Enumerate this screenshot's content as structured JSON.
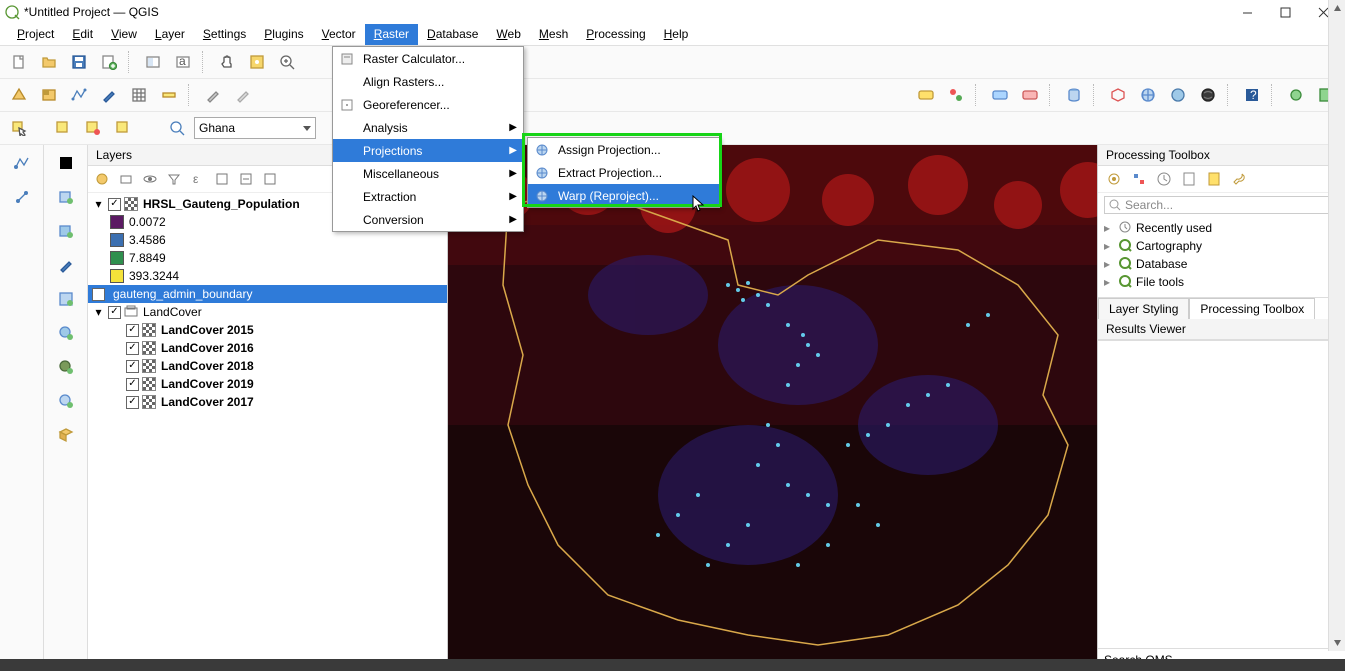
{
  "window": {
    "title": "*Untitled Project — QGIS"
  },
  "menubar": [
    "Project",
    "Edit",
    "View",
    "Layer",
    "Settings",
    "Plugins",
    "Vector",
    "Raster",
    "Database",
    "Web",
    "Mesh",
    "Processing",
    "Help"
  ],
  "menubar_active": "Raster",
  "toolbar3": {
    "combo_value": "Ghana"
  },
  "layers_panel": {
    "title": "Layers",
    "tree": [
      {
        "expand": "open",
        "checked": true,
        "icon": "raster",
        "label": "HRSL_Gauteng_Population",
        "bold": true,
        "children": [
          {
            "swatch": "#5b1a63",
            "label": "0.0072"
          },
          {
            "swatch": "#3b6fb0",
            "label": "3.4586"
          },
          {
            "swatch": "#2f8f4e",
            "label": "7.8849"
          },
          {
            "swatch": "#f4e23a",
            "label": "393.3244"
          }
        ]
      },
      {
        "checked": true,
        "icon": "vector",
        "label": "gauteng_admin_boundary",
        "selected": true
      },
      {
        "expand": "open",
        "checked": true,
        "icon": "group",
        "label": "LandCover",
        "children": [
          {
            "checked": true,
            "icon": "raster",
            "label": "LandCover 2015",
            "bold": true
          },
          {
            "checked": true,
            "icon": "raster",
            "label": "LandCover 2016",
            "bold": true
          },
          {
            "checked": true,
            "icon": "raster",
            "label": "LandCover 2018",
            "bold": true
          },
          {
            "checked": true,
            "icon": "raster",
            "label": "LandCover 2019",
            "bold": true
          },
          {
            "checked": true,
            "icon": "raster",
            "label": "LandCover 2017",
            "bold": true
          }
        ]
      }
    ]
  },
  "raster_menu": {
    "items": [
      {
        "label": "Raster Calculator...",
        "icon": "calc"
      },
      {
        "label": "Align Rasters..."
      },
      {
        "label": "Georeferencer...",
        "icon": "georef"
      },
      {
        "label": "Analysis",
        "submenu": true
      },
      {
        "label": "Projections",
        "submenu": true,
        "highlight": true
      },
      {
        "label": "Miscellaneous",
        "submenu": true
      },
      {
        "label": "Extraction",
        "submenu": true
      },
      {
        "label": "Conversion",
        "submenu": true
      }
    ]
  },
  "projections_submenu": {
    "items": [
      {
        "label": "Assign Projection...",
        "icon": "globe"
      },
      {
        "label": "Extract Projection...",
        "icon": "globe"
      },
      {
        "label": "Warp (Reproject)...",
        "icon": "warp",
        "highlight": true
      }
    ]
  },
  "processing": {
    "title": "Processing Toolbox",
    "search_placeholder": "Search...",
    "tree": [
      {
        "icon": "clock",
        "label": "Recently used"
      },
      {
        "icon": "q",
        "label": "Cartography"
      },
      {
        "icon": "q",
        "label": "Database"
      },
      {
        "icon": "q",
        "label": "File tools"
      }
    ],
    "tabs": [
      "Layer Styling",
      "Processing Toolbox"
    ],
    "active_tab": "Processing Toolbox",
    "results_title": "Results Viewer",
    "qms_title": "Search QMS"
  }
}
